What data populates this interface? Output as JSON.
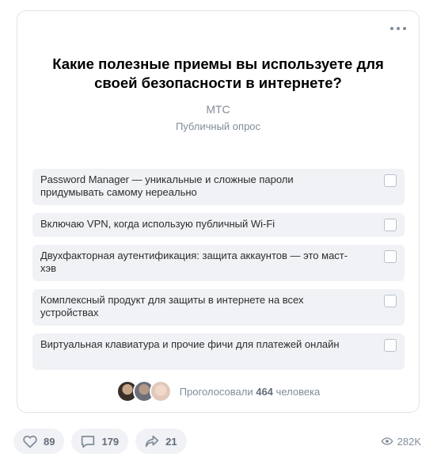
{
  "poll": {
    "question": "Какие полезные приемы вы используете для своей безопасности в интернете?",
    "author": "МТС",
    "poll_type": "Публичный опрос",
    "options": [
      {
        "label": "Password Manager — уникальные и сложные пароли придумывать самому нереально",
        "checked": false
      },
      {
        "label": "Включаю VPN, когда использую публичный Wi-Fi",
        "checked": false
      },
      {
        "label": "Двухфакторная аутентификация: защита аккаунтов — это маст-хэв",
        "checked": false
      },
      {
        "label": "Комплексный продукт для защиты в интернете на всех устройствах",
        "checked": false
      },
      {
        "label": "Виртуальная клавиатура и прочие фичи для платежей онлайн",
        "checked": false
      }
    ],
    "voters": {
      "prefix": "Проголосовали",
      "count": "464",
      "suffix": "человека"
    }
  },
  "actions": {
    "likes": "89",
    "comments": "179",
    "shares": "21",
    "views": "282K"
  },
  "icons": {
    "menu": "more-horizontal-icon",
    "like": "heart-icon",
    "comment": "comment-icon",
    "share": "share-icon",
    "views": "eye-icon"
  },
  "colors": {
    "secondary_text": "#818c99",
    "option_bg": "#f0f2f5",
    "checkbox_border": "#b8c1cc"
  }
}
